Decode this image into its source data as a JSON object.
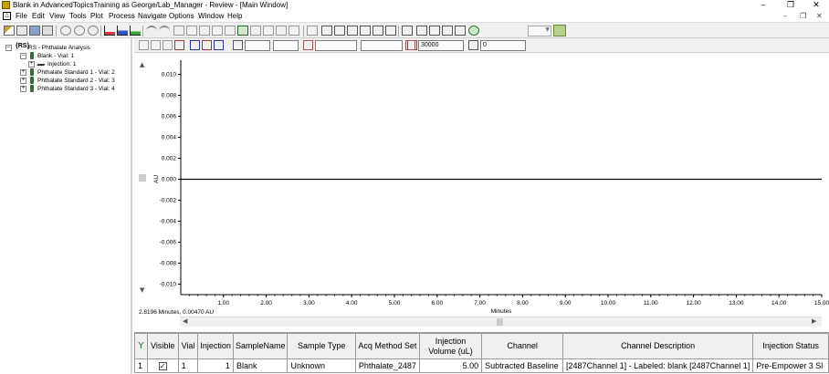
{
  "window": {
    "title": "Blank in AdvancedTopicsTraining as George/Lab_Manager - Review - [Main Window]",
    "minimize": "–",
    "restore": "❐",
    "close": "✕"
  },
  "menu": {
    "items": [
      "File",
      "Edit",
      "View",
      "Tools",
      "Plot",
      "Process",
      "Navigate",
      "Options",
      "Window",
      "Help"
    ],
    "mdi_minimize": "–",
    "mdi_restore": "❐",
    "mdi_close": "✕"
  },
  "toolbar2": {
    "field_value_1": "30000",
    "field_value_2": "0"
  },
  "tree": {
    "root": "RS - Phthalate Analysis",
    "items": [
      {
        "label": "Blank - Vial: 1"
      },
      {
        "label": "Injection: 1"
      },
      {
        "label": "Phthalate Standard 1 - Vial: 2"
      },
      {
        "label": "Phthalate Standard 2 - Vial: 3"
      },
      {
        "label": "Phthalate Standard 3 - Vial: 4"
      }
    ]
  },
  "chart_data": {
    "type": "line",
    "xlabel": "Minutes",
    "ylabel": "AU",
    "xlim": [
      0,
      15.0
    ],
    "ylim": [
      -0.011,
      0.011
    ],
    "x_ticks": [
      "1.00",
      "2.00",
      "3.00",
      "4.00",
      "5.00",
      "6.00",
      "7.00",
      "8.00",
      "9.00",
      "10.00",
      "11.00",
      "12.00",
      "13.00",
      "14.00",
      "15.00"
    ],
    "y_ticks": [
      "0.010",
      "0.008",
      "0.006",
      "0.004",
      "0.002",
      "0.000",
      "-0.002",
      "-0.004",
      "-0.006",
      "-0.008",
      "-0.010"
    ],
    "series": [
      {
        "x": [
          0,
          15.0
        ],
        "y": [
          0.0,
          0.0
        ]
      }
    ],
    "grid": false
  },
  "plot": {
    "cursor_readout": "2.8196 Minutes, 0.00470 AU"
  },
  "table": {
    "headers": [
      "Visible",
      "Vial",
      "Injection",
      "SampleName",
      "Sample Type",
      "Acq Method Set",
      "Injection Volume (uL)",
      "Channel",
      "Channel Description",
      "Injection Status"
    ],
    "row_number": "1",
    "visible_mark": "✓",
    "row": {
      "vial": "1",
      "injection": "1",
      "sample_name": "Blank",
      "sample_type": "Unknown",
      "acq_method_set": "Phthalate_2487",
      "injection_volume": "5.00",
      "channel": "Subtracted Baseline",
      "channel_description": "[2487Channel 1] - Labeled: blank [2487Channel 1]",
      "injection_status": "Pre-Empower 3 Sl"
    }
  }
}
